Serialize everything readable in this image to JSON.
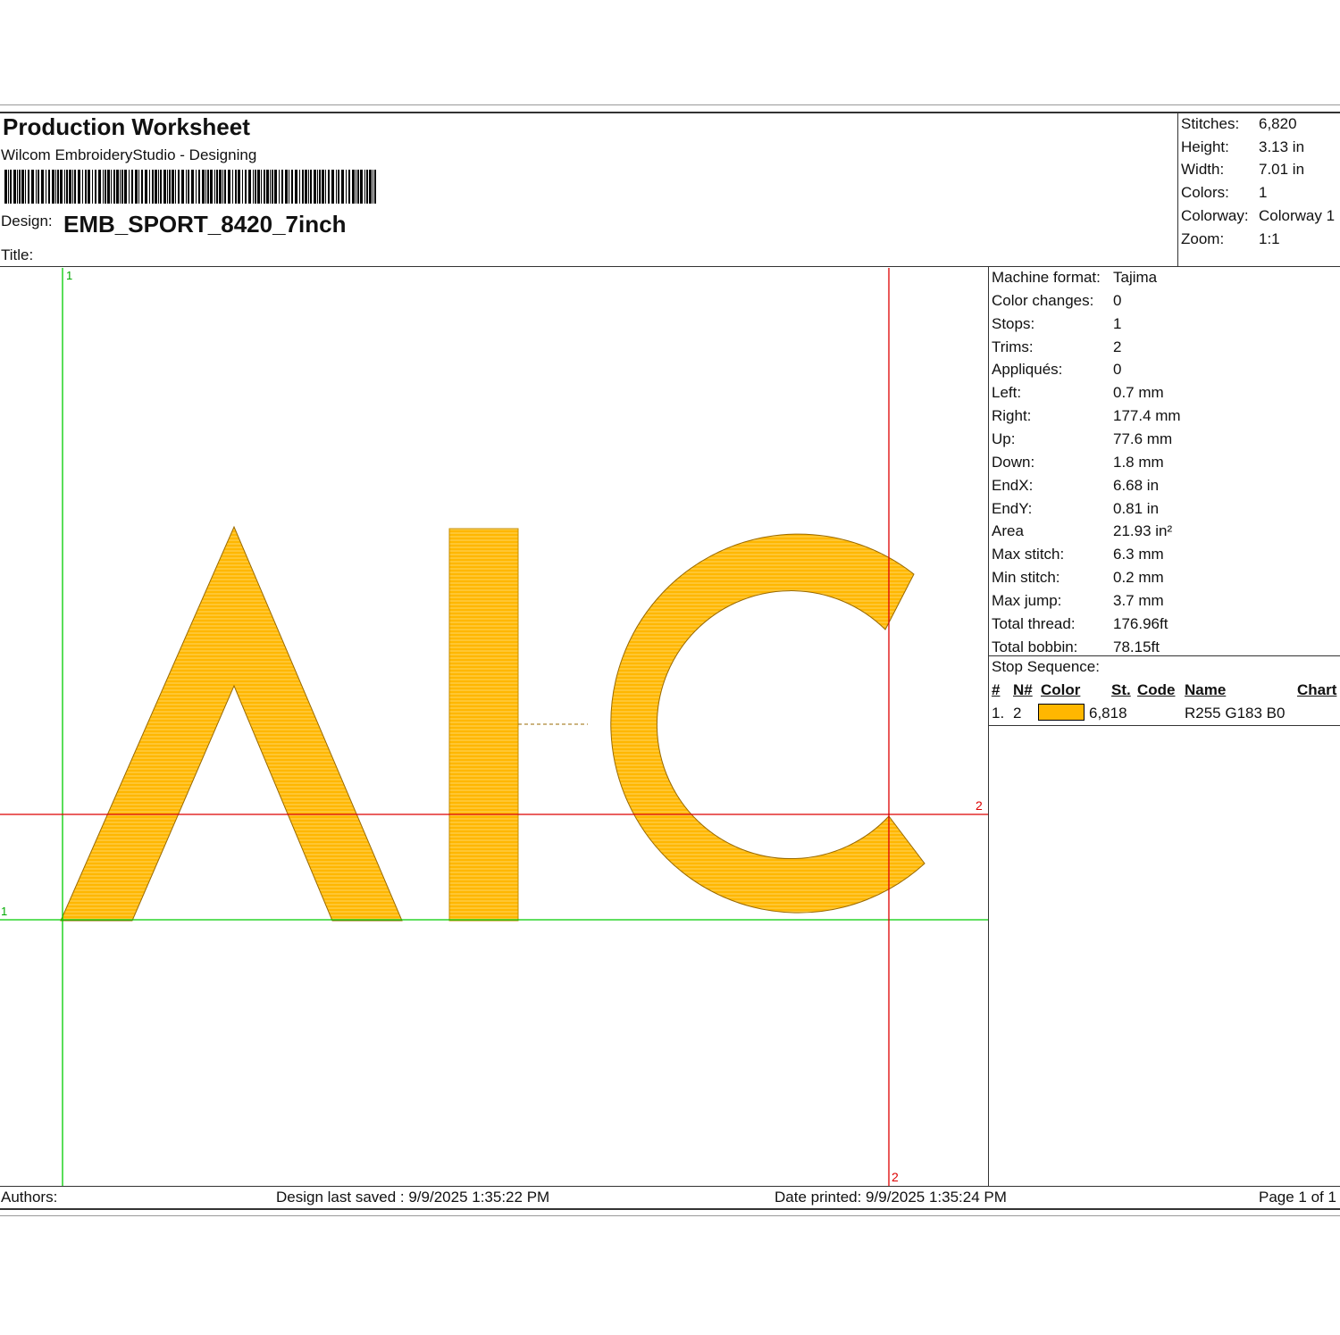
{
  "header": {
    "title": "Production Worksheet",
    "subtitle": "Wilcom EmbroideryStudio - Designing",
    "design_label": "Design:",
    "design_name": "EMB_SPORT_8420_7inch",
    "title_label": "Title:"
  },
  "summary": [
    {
      "label": "Stitches:",
      "value": "6,820"
    },
    {
      "label": "Height:",
      "value": "3.13 in"
    },
    {
      "label": "Width:",
      "value": "7.01 in"
    },
    {
      "label": "Colors:",
      "value": "1"
    },
    {
      "label": "Colorway:",
      "value": "Colorway 1"
    },
    {
      "label": "Zoom:",
      "value": "1:1"
    }
  ],
  "details": [
    {
      "label": "Machine format:",
      "value": "Tajima"
    },
    {
      "label": "Color changes:",
      "value": "0"
    },
    {
      "label": "Stops:",
      "value": "1"
    },
    {
      "label": "Trims:",
      "value": "2"
    },
    {
      "label": "Appliqués:",
      "value": "0"
    },
    {
      "label": "Left:",
      "value": "0.7 mm"
    },
    {
      "label": "Right:",
      "value": "177.4 mm"
    },
    {
      "label": "Up:",
      "value": "77.6 mm"
    },
    {
      "label": "Down:",
      "value": "1.8 mm"
    },
    {
      "label": "EndX:",
      "value": "6.68 in"
    },
    {
      "label": "EndY:",
      "value": "0.81 in"
    },
    {
      "label": "Area",
      "value": " 21.93 in²"
    },
    {
      "label": "Max stitch:",
      "value": "6.3 mm"
    },
    {
      "label": "Min stitch:",
      "value": "0.2 mm"
    },
    {
      "label": "Max jump:",
      "value": "3.7 mm"
    },
    {
      "label": "Total thread:",
      "value": "176.96ft"
    },
    {
      "label": "Total bobbin:",
      "value": "78.15ft"
    }
  ],
  "stop_sequence": {
    "label": "Stop Sequence:",
    "columns": [
      "#",
      "N#",
      "Color",
      "St.",
      "Code",
      "Name",
      "Chart"
    ],
    "rows": [
      {
        "index": "1.",
        "needle": "2",
        "color": "#FFB700",
        "stitches": "6,818",
        "code": "",
        "name": "R255 G183 B0",
        "chart": ""
      }
    ]
  },
  "design_view": {
    "letters": "AIC",
    "thread_color": "#FFB700",
    "guide_labels": {
      "green_top": "1",
      "green_left": "1",
      "red_right": "2",
      "red_bottom": "2"
    }
  },
  "footer": {
    "authors": "Authors:",
    "saved": "Design last saved : 9/9/2025 1:35:22 PM",
    "printed": "Date printed: 9/9/2025 1:35:24 PM",
    "page": "Page 1 of 1"
  }
}
